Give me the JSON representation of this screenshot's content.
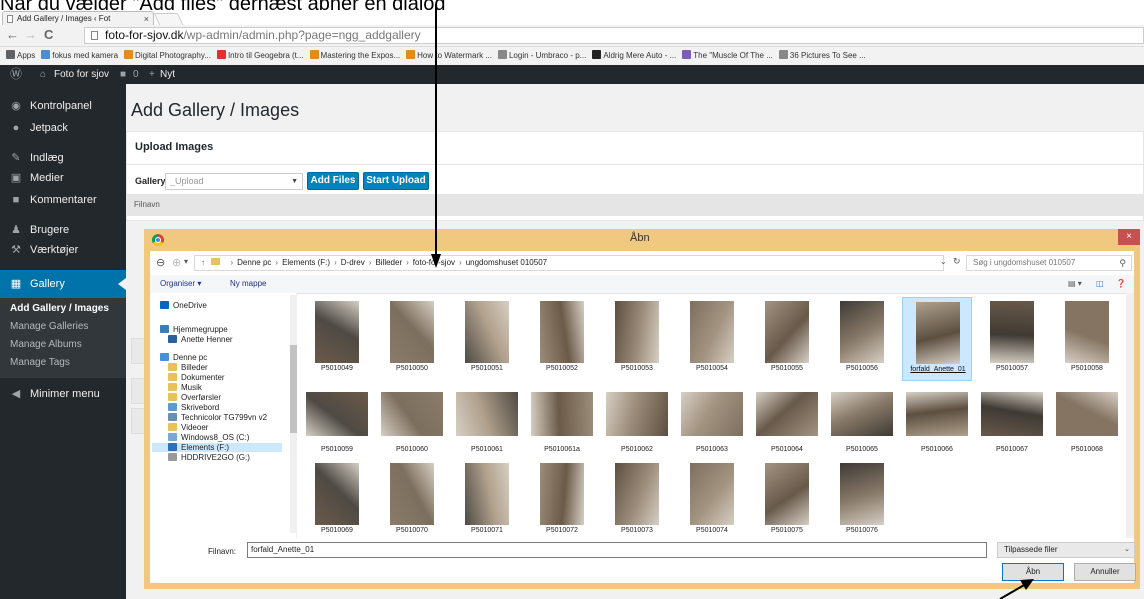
{
  "caption": "Når du vælger \"Add files\" dernæst åbner en dialog",
  "browser": {
    "tab_title": "Add Gallery / Images ‹ Fot",
    "tab_close": "×",
    "url_domain": "foto-for-sjov.dk",
    "url_path": "/wp-admin/admin.php?page=ngg_addgallery",
    "bookmarks": [
      {
        "label": "Apps",
        "color": "#5f6368"
      },
      {
        "label": "fokus med kamera",
        "color": "#4a8fd6"
      },
      {
        "label": "Digital Photography...",
        "color": "#e58a1c"
      },
      {
        "label": "Intro til Geogebra (t...",
        "color": "#e03030"
      },
      {
        "label": "Mastering the Expos...",
        "color": "#e58a1c"
      },
      {
        "label": "How to Watermark ...",
        "color": "#e58a1c"
      },
      {
        "label": "Login - Umbraco - p...",
        "color": "#888888"
      },
      {
        "label": "Aldrig Mere Auto - ...",
        "color": "#222222"
      },
      {
        "label": "The \"Muscle Of The ...",
        "color": "#7b5cb8"
      },
      {
        "label": "36 Pictures To See ...",
        "color": "#888888"
      }
    ]
  },
  "adminbar": {
    "site_name": "Foto for sjov",
    "comments": "0",
    "new_label": "Nyt"
  },
  "sidebar": {
    "items": [
      {
        "label": "Kontrolpanel",
        "icon": "dashboard-icon",
        "glyph": "◉"
      },
      {
        "label": "Jetpack",
        "icon": "jetpack-icon",
        "glyph": "●"
      },
      {
        "label": "Indlæg",
        "icon": "pin-icon",
        "glyph": "✎"
      },
      {
        "label": "Medier",
        "icon": "media-icon",
        "glyph": "▣"
      },
      {
        "label": "Kommentarer",
        "icon": "comment-icon",
        "glyph": "■"
      },
      {
        "label": "Brugere",
        "icon": "users-icon",
        "glyph": "♟"
      },
      {
        "label": "Værktøjer",
        "icon": "wrench-icon",
        "glyph": "⚒"
      },
      {
        "label": "Gallery",
        "icon": "gallery-icon",
        "glyph": "▦"
      }
    ],
    "submenu": [
      "Add Gallery / Images",
      "Manage Galleries",
      "Manage Albums",
      "Manage Tags"
    ],
    "collapse": "Minimer menu"
  },
  "main": {
    "title": "Add Gallery / Images",
    "upload_title": "Upload Images",
    "gallery_label": "Gallery",
    "gallery_select": "_Upload",
    "add_files": "Add Files",
    "start_upload": "Start Upload",
    "filename_header": "Filnavn"
  },
  "dialog": {
    "title": "Åbn",
    "close": "×",
    "path": [
      "Denne pc",
      "Elements (F:)",
      "D-drev",
      "Billeder",
      "foto-for-sjov",
      "ungdomshuset 010507"
    ],
    "search_placeholder": "Søg i ungdomshuset 010507",
    "organize": "Organiser ▾",
    "new_folder": "Ny mappe",
    "tree": [
      {
        "label": "OneDrive",
        "color": "#0a62c9",
        "indent": 0
      },
      {
        "label": "Hjemmegruppe",
        "color": "#3b7bbf",
        "indent": 0
      },
      {
        "label": "Anette Henner",
        "color": "#2c5f9e",
        "indent": 1
      },
      {
        "label": "Denne pc",
        "color": "#4a90d9",
        "indent": 0
      },
      {
        "label": "Billeder",
        "color": "#e8c15a",
        "indent": 1
      },
      {
        "label": "Dokumenter",
        "color": "#e8c15a",
        "indent": 1
      },
      {
        "label": "Musik",
        "color": "#e8c15a",
        "indent": 1
      },
      {
        "label": "Overførsler",
        "color": "#e8c15a",
        "indent": 1
      },
      {
        "label": "Skrivebord",
        "color": "#5b9bd5",
        "indent": 1
      },
      {
        "label": "Technicolor TG799vn v2",
        "color": "#6b8fb3",
        "indent": 1
      },
      {
        "label": "Videoer",
        "color": "#e8c15a",
        "indent": 1
      },
      {
        "label": "Windows8_OS (C:)",
        "color": "#7aa7d4",
        "indent": 1
      },
      {
        "label": "Elements (F:)",
        "color": "#2e6fc4",
        "indent": 1
      },
      {
        "label": "HDDRIVE2GO (G:)",
        "color": "#9a9a9a",
        "indent": 1
      }
    ],
    "files": [
      "P5010049",
      "P5010050",
      "P5010051",
      "P5010052",
      "P5010053",
      "P5010054",
      "P5010055",
      "P5010056",
      "forfald_Anette_01",
      "P5010057",
      "P5010058",
      "P5010059",
      "P5010060",
      "P5010061",
      "P5010061a",
      "P5010062",
      "P5010063",
      "P5010064",
      "P5010065",
      "P5010066",
      "P5010067",
      "P5010068",
      "P5010069",
      "P5010070",
      "P5010071",
      "P5010072",
      "P5010073",
      "P5010074",
      "P5010075",
      "P5010076"
    ],
    "selected_file": "forfald_Anette_01",
    "filename_label": "Filnavn:",
    "filename_value": "forfald_Anette_01",
    "filter": "Tilpassede filer",
    "open": "Åbn",
    "cancel": "Annuller"
  },
  "colors": {
    "wp_dark": "#23282d",
    "wp_blue": "#0073aa",
    "dialog_frame": "#f0c880"
  }
}
